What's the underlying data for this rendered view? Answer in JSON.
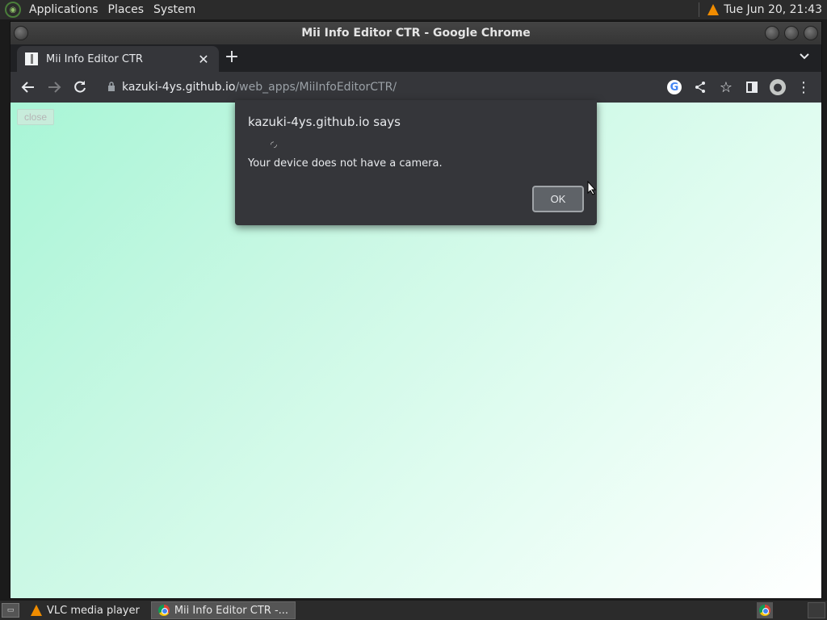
{
  "top_panel": {
    "menus": [
      "Applications",
      "Places",
      "System"
    ],
    "clock": "Tue Jun 20, 21:43"
  },
  "window": {
    "title": "Mii Info Editor CTR - Google Chrome"
  },
  "tab": {
    "title": "Mii Info Editor CTR",
    "close_glyph": "✕",
    "new_tab_glyph": "+"
  },
  "omnibox": {
    "host": "kazuki-4ys.github.io",
    "path": "/web_apps/MiiInfoEditorCTR/"
  },
  "page": {
    "close_label": "close",
    "gradient_start": "#a8f5d6",
    "gradient_end": "#ffffff"
  },
  "dialog": {
    "title": "kazuki-4ys.github.io says",
    "message": "Your device does not have a camera.",
    "ok_label": "OK"
  },
  "taskbar": {
    "tasks": [
      {
        "label": "VLC media player",
        "icon": "vlc-icon"
      },
      {
        "label": "Mii Info Editor CTR -...",
        "icon": "chrome-icon"
      }
    ]
  }
}
